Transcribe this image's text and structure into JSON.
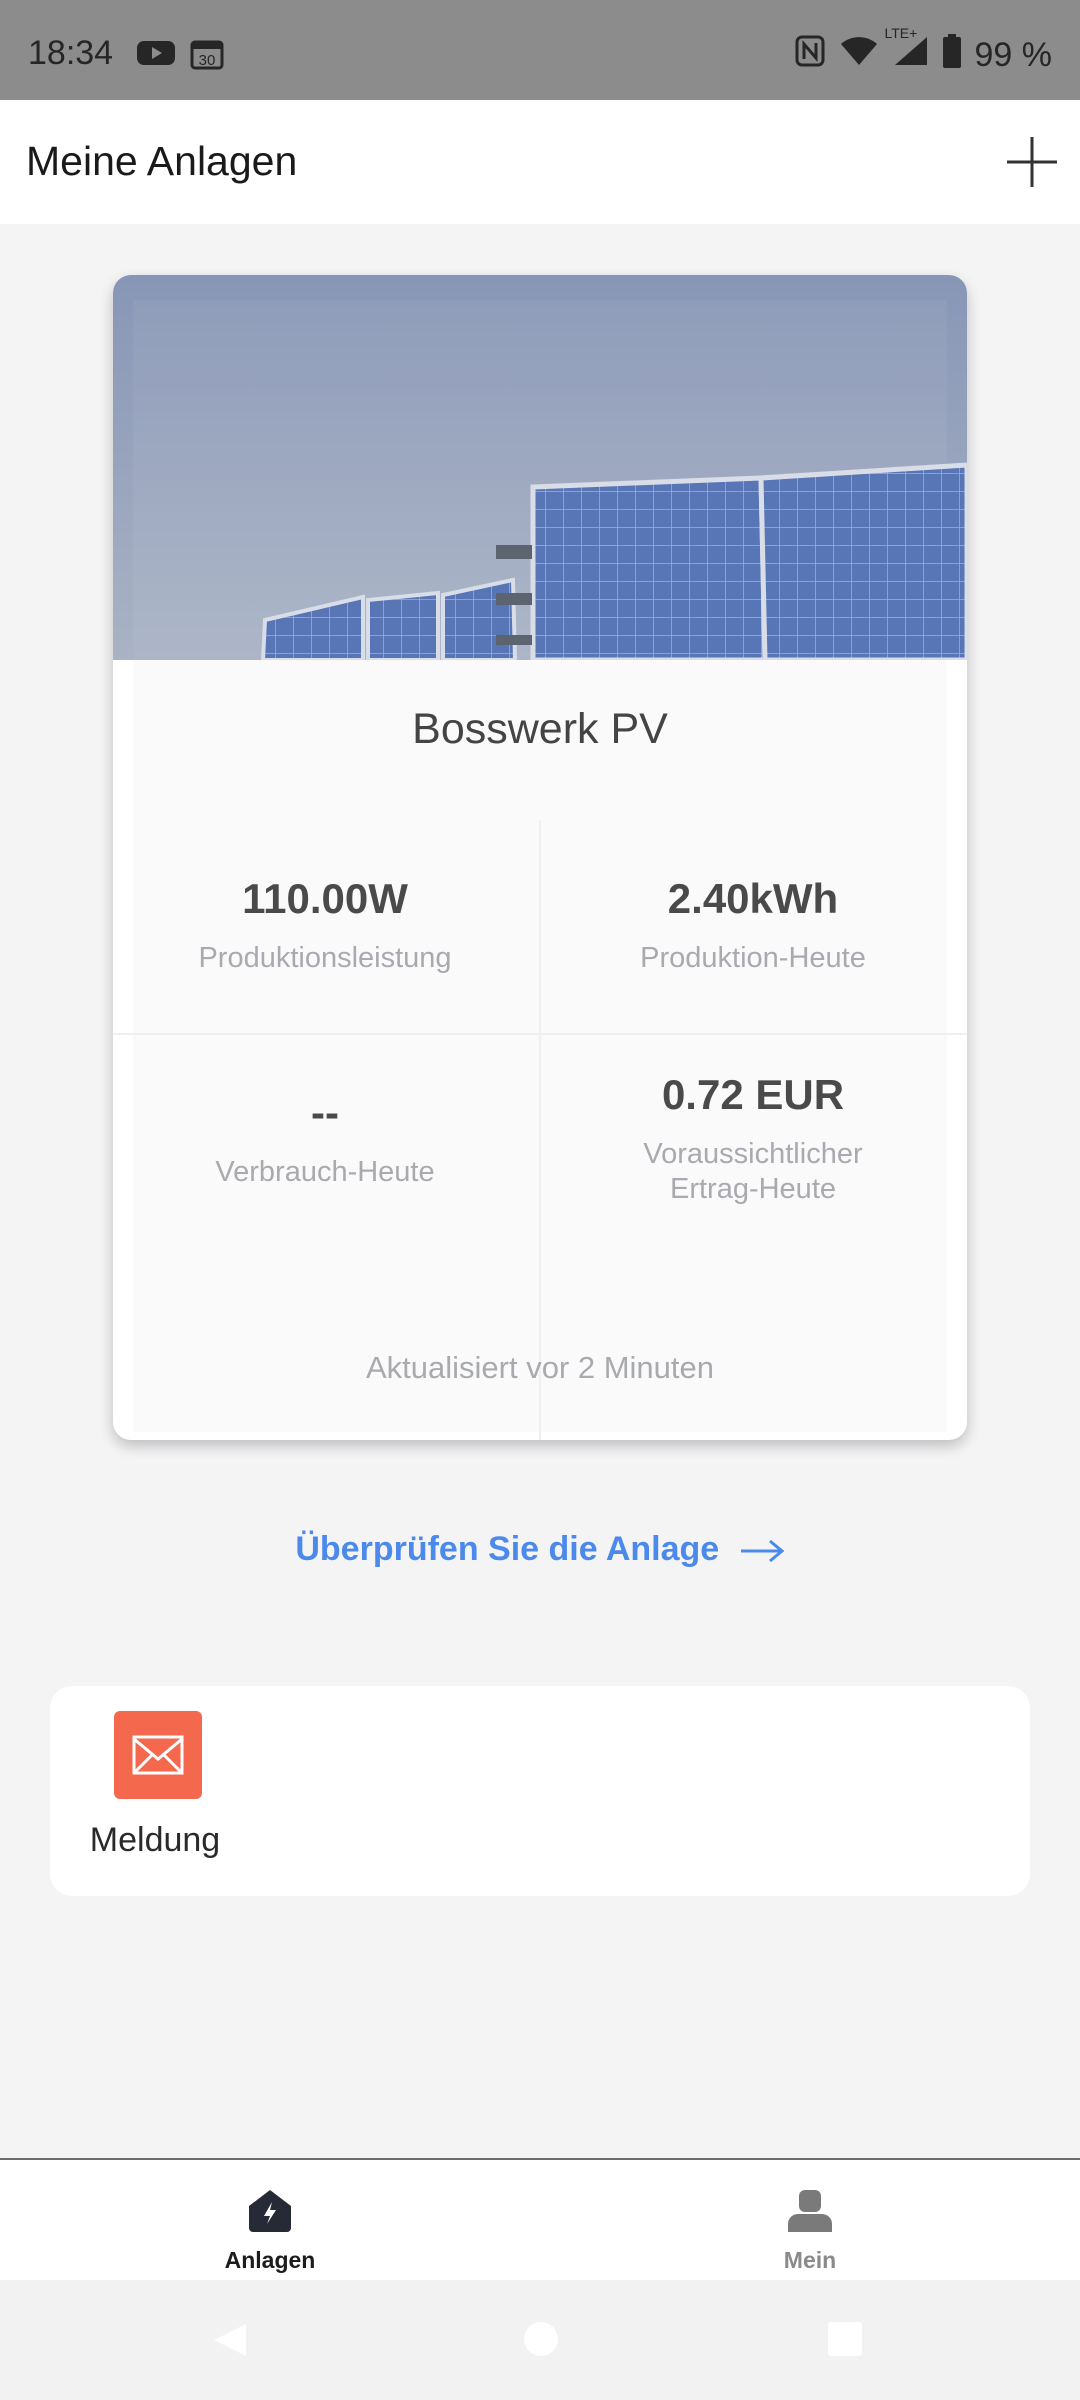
{
  "status_bar": {
    "time": "18:34",
    "battery": "99 %",
    "network": "LTE+",
    "icons": [
      "youtube-icon",
      "calendar-icon",
      "nfc-icon",
      "wifi-icon",
      "signal-icon",
      "battery-icon"
    ]
  },
  "header": {
    "title": "Meine Anlagen",
    "add_icon": "plus-icon"
  },
  "plant": {
    "name": "Bosswerk PV",
    "stats": [
      {
        "value": "110.00W",
        "label": "Produktionsleistung"
      },
      {
        "value": "2.40kWh",
        "label": "Produktion-Heute"
      },
      {
        "value": "--",
        "label": "Verbrauch-Heute"
      },
      {
        "value": "0.72 EUR",
        "label": "Voraussichtlicher Ertrag-Heute"
      }
    ],
    "updated": "Aktualisiert vor 2 Minuten"
  },
  "check_link": {
    "label": "Überprüfen Sie die Anlage",
    "icon": "arrow-right-icon",
    "color": "#4b8aea"
  },
  "messages": {
    "label": "Meldung",
    "icon": "envelope-icon",
    "icon_bg": "#f4694e"
  },
  "bottom_nav": {
    "items": [
      {
        "label": "Anlagen",
        "icon": "home-bolt-icon",
        "active": true
      },
      {
        "label": "Mein",
        "icon": "user-icon",
        "active": false
      }
    ]
  },
  "system_nav": [
    "back-icon",
    "home-icon",
    "recents-icon"
  ]
}
